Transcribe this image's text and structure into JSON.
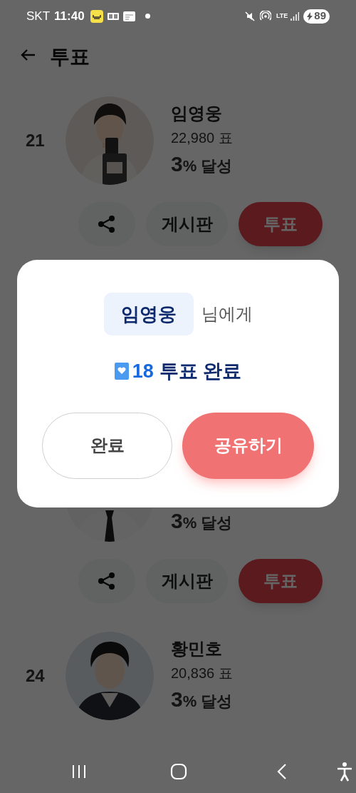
{
  "status_bar": {
    "carrier": "SKT",
    "time": "11:40",
    "network": "LTE",
    "battery": "89"
  },
  "header": {
    "title": "투표"
  },
  "candidates": [
    {
      "rank": "21",
      "name": "임영웅",
      "votes": "22,980 표",
      "percent": "3",
      "percent_label": "% 달성",
      "board": "게시판",
      "vote": "투표"
    },
    {
      "percent": "3",
      "percent_label": "% 달성",
      "board": "게시판",
      "vote": "투표"
    },
    {
      "rank": "24",
      "name": "황민호",
      "votes": "20,836 표",
      "percent": "3",
      "percent_label": "% 달성"
    }
  ],
  "dialog": {
    "name": "임영웅",
    "suffix": "님에게",
    "count": "18",
    "message": "투표 완료",
    "buttons": [
      {
        "label": "완료",
        "kind": "secondary"
      },
      {
        "label": "공유하기",
        "kind": "primary"
      }
    ]
  }
}
